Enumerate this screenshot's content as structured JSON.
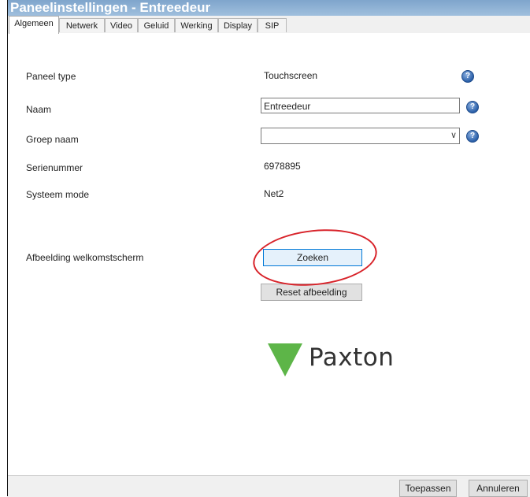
{
  "window": {
    "title": "Paneelinstellingen - Entreedeur"
  },
  "tabs": [
    {
      "label": "Algemeen",
      "active": true
    },
    {
      "label": "Netwerk"
    },
    {
      "label": "Video"
    },
    {
      "label": "Geluid"
    },
    {
      "label": "Werking"
    },
    {
      "label": "Display"
    },
    {
      "label": "SIP"
    }
  ],
  "fields": {
    "panel_type": {
      "label": "Paneel type",
      "value": "Touchscreen"
    },
    "name": {
      "label": "Naam",
      "value": "Entreedeur"
    },
    "group_name": {
      "label": "Groep naam",
      "value": ""
    },
    "serial": {
      "label": "Serienummer",
      "value": "6978895"
    },
    "system_mode": {
      "label": "Systeem mode",
      "value": "Net2"
    },
    "welcome_image": {
      "label": "Afbeelding welkomstscherm"
    }
  },
  "buttons": {
    "search": "Zoeken",
    "reset_image": "Reset afbeelding",
    "apply": "Toepassen",
    "cancel": "Annuleren"
  },
  "help_glyph": "?",
  "dropdown_glyph": "∨",
  "logo": {
    "text": "Paxton",
    "mark_color": "#5db548"
  },
  "annotation": {
    "color": "#d8232a"
  }
}
